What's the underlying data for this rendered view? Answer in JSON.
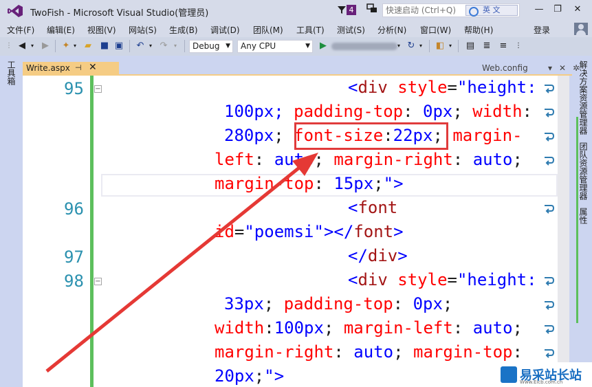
{
  "window": {
    "title": "TwoFish - Microsoft Visual Studio(管理员)",
    "notification_count": "4",
    "quick_launch_placeholder": "快速启动 (Ctrl+Q)",
    "ime_label": "英 文"
  },
  "menu": {
    "items": [
      "文件(F)",
      "编辑(E)",
      "视图(V)",
      "网站(S)",
      "生成(B)",
      "调试(D)",
      "团队(M)",
      "工具(T)",
      "测试(S)",
      "分析(N)",
      "窗口(W)",
      "帮助(H)"
    ],
    "login": "登录"
  },
  "toolbar": {
    "config": "Debug",
    "platform": "Any CPU"
  },
  "side_panels": {
    "left": "工具箱",
    "right": [
      "解决方案资源管理器",
      "团队资源管理器",
      "属性"
    ]
  },
  "tabs": {
    "active": "Write.aspx",
    "other": "Web.config"
  },
  "editor": {
    "line_numbers": [
      "95",
      "96",
      "97",
      "98"
    ],
    "lines": [
      {
        "segments": [
          [
            "br",
            "<"
          ],
          [
            "tag",
            "div"
          ],
          [
            "punct",
            " "
          ],
          [
            "attr",
            "style"
          ],
          [
            "punct",
            "="
          ],
          [
            "str",
            "\"height:"
          ]
        ]
      },
      {
        "segments": [
          [
            "str",
            "100px; "
          ],
          [
            "attr",
            "padding-top"
          ],
          [
            "punct",
            ": "
          ],
          [
            "val",
            "0px"
          ],
          [
            "punct",
            "; "
          ],
          [
            "attr",
            "width"
          ],
          [
            "punct",
            ":"
          ]
        ]
      },
      {
        "segments": [
          [
            "val",
            "280px"
          ],
          [
            "punct",
            "; "
          ],
          [
            "attr",
            "font-size"
          ],
          [
            "punct",
            ":"
          ],
          [
            "val",
            "22px"
          ],
          [
            "punct",
            "; "
          ],
          [
            "attr",
            "margin-"
          ]
        ]
      },
      {
        "segments": [
          [
            "attr",
            "left"
          ],
          [
            "punct",
            ": "
          ],
          [
            "val",
            "auto"
          ],
          [
            "punct",
            "; "
          ],
          [
            "attr",
            "margin-right"
          ],
          [
            "punct",
            ": "
          ],
          [
            "val",
            "auto"
          ],
          [
            "punct",
            ";"
          ]
        ]
      },
      {
        "segments": [
          [
            "attr",
            "margin-top"
          ],
          [
            "punct",
            ": "
          ],
          [
            "val",
            "15px"
          ],
          [
            "punct",
            ";"
          ],
          [
            "str",
            "\""
          ],
          [
            "br",
            ">"
          ]
        ]
      },
      {
        "segments": [
          [
            "br",
            "<"
          ],
          [
            "tag",
            "font"
          ]
        ]
      },
      {
        "segments": [
          [
            "attr",
            "id"
          ],
          [
            "punct",
            "="
          ],
          [
            "str",
            "\"poemsi\""
          ],
          [
            "br",
            "></"
          ],
          [
            "tag",
            "font"
          ],
          [
            "br",
            ">"
          ]
        ]
      },
      {
        "segments": [
          [
            "br",
            "</"
          ],
          [
            "tag",
            "div"
          ],
          [
            "br",
            ">"
          ]
        ]
      },
      {
        "segments": [
          [
            "br",
            "<"
          ],
          [
            "tag",
            "div"
          ],
          [
            "punct",
            " "
          ],
          [
            "attr",
            "style"
          ],
          [
            "punct",
            "="
          ],
          [
            "str",
            "\"height:"
          ]
        ]
      },
      {
        "segments": [
          [
            "val",
            "33px"
          ],
          [
            "punct",
            "; "
          ],
          [
            "attr",
            "padding-top"
          ],
          [
            "punct",
            ": "
          ],
          [
            "val",
            "0px"
          ],
          [
            "punct",
            ";"
          ]
        ]
      },
      {
        "segments": [
          [
            "attr",
            "width"
          ],
          [
            "punct",
            ":"
          ],
          [
            "val",
            "100px"
          ],
          [
            "punct",
            "; "
          ],
          [
            "attr",
            "margin-left"
          ],
          [
            "punct",
            ": "
          ],
          [
            "val",
            "auto"
          ],
          [
            "punct",
            ";"
          ]
        ]
      },
      {
        "segments": [
          [
            "attr",
            "margin-right"
          ],
          [
            "punct",
            ": "
          ],
          [
            "val",
            "auto"
          ],
          [
            "punct",
            "; "
          ],
          [
            "attr",
            "margin-top"
          ],
          [
            "punct",
            ":"
          ]
        ]
      },
      {
        "segments": [
          [
            "val",
            "20px"
          ],
          [
            "punct",
            ";"
          ],
          [
            "str",
            "\""
          ],
          [
            "br",
            ">"
          ]
        ]
      }
    ]
  },
  "watermark": {
    "text": "易采站长站",
    "url": "Www.Eicb.com.cn"
  }
}
